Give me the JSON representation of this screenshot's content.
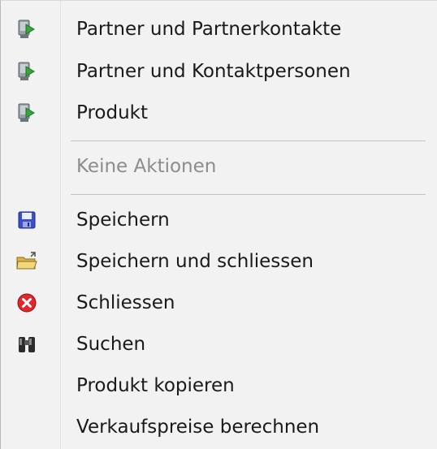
{
  "menu": {
    "items": [
      {
        "label": "Partner und Partnerkontakte",
        "icon": "green-arrow-document-icon"
      },
      {
        "label": "Partner und Kontaktpersonen",
        "icon": "green-arrow-document-icon"
      },
      {
        "label": "Produkt",
        "icon": "green-arrow-document-icon"
      },
      {
        "label": "Keine Aktionen",
        "disabled": true
      },
      {
        "label": "Speichern",
        "icon": "floppy-disk-icon"
      },
      {
        "label": "Speichern und schliessen",
        "icon": "open-folder-icon"
      },
      {
        "label": "Schliessen",
        "icon": "red-close-icon"
      },
      {
        "label": "Suchen",
        "icon": "binoculars-icon"
      },
      {
        "label": "Produkt kopieren"
      },
      {
        "label": "Verkaufspreise berechnen"
      }
    ]
  }
}
